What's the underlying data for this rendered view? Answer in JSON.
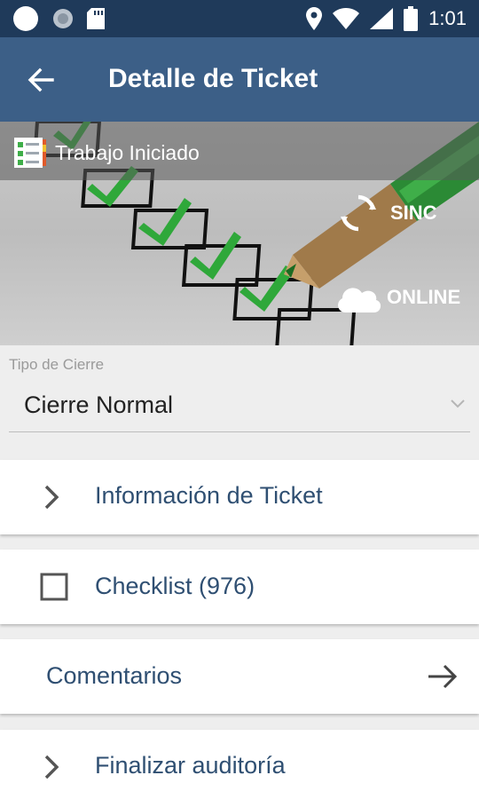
{
  "status_bar": {
    "time": "1:01",
    "icons": [
      "circle-icon",
      "dot-icon",
      "sd-card-icon",
      "location-icon",
      "wifi-icon",
      "signal-icon",
      "battery-icon"
    ]
  },
  "app_bar": {
    "title": "Detalle de Ticket",
    "back_icon": "arrow-back-icon"
  },
  "banner": {
    "status_text": "Trabajo Iniciado",
    "sync_label": "SINC",
    "online_label": "ONLINE"
  },
  "closure": {
    "label": "Tipo de Cierre",
    "value": "Cierre Normal"
  },
  "sections": {
    "ticket_info": "Información de Ticket",
    "checklist": "Checklist (976)",
    "comments": "Comentarios",
    "finish_audit": "Finalizar auditoría"
  },
  "colors": {
    "status_bar": "#1f3a5a",
    "app_bar": "#3c5f87",
    "section_text": "#2f4f72",
    "checkmark_green": "#2fa83a"
  }
}
